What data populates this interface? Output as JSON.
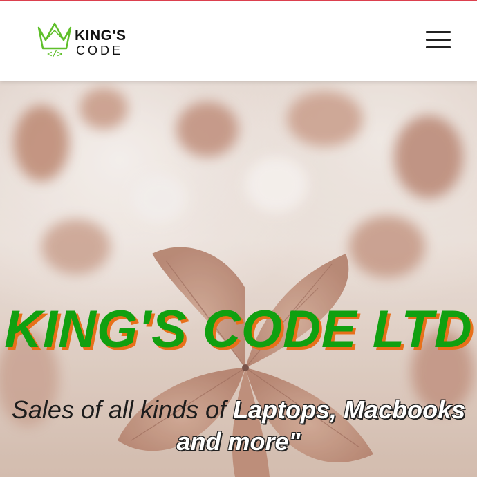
{
  "header": {
    "logo": {
      "line1": "KING'S",
      "line2": "CODE",
      "icon": "crown-code-icon"
    },
    "menu": {
      "icon": "hamburger-menu-icon"
    }
  },
  "hero": {
    "title": "KING'S CODE LTD",
    "subtitle_plain": "Sales of all kinds of ",
    "subtitle_highlight": "Laptops, Macbooks and more\""
  },
  "colors": {
    "top_border": "#e0424f",
    "title_green": "#10a010",
    "title_shadow_orange": "#e8701a",
    "logo_green": "#5fbf2a"
  }
}
